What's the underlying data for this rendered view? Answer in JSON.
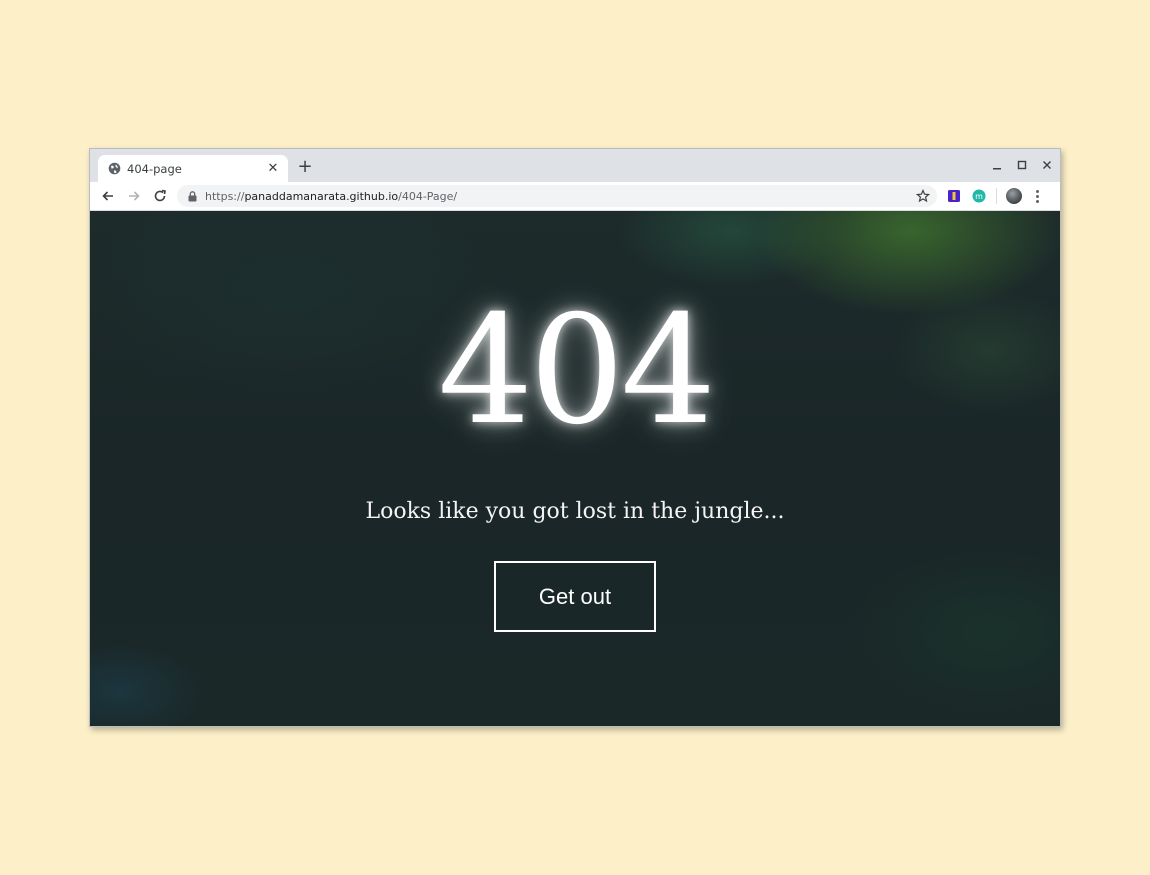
{
  "browser": {
    "tab": {
      "title": "404-page",
      "favicon": "globe-icon"
    },
    "new_tab_label": "+",
    "url": {
      "scheme": "https://",
      "host": "panaddamanarata.github.io",
      "path": "/404-Page/"
    },
    "extensions": [
      "extension-purple-icon",
      "extension-m-icon"
    ],
    "window_controls": [
      "minimize",
      "maximize",
      "close"
    ]
  },
  "page": {
    "headline": "404",
    "subtitle": "Looks like you got lost in the jungle...",
    "button_label": "Get out"
  },
  "colors": {
    "background": "#fdf0c9",
    "page_bg": "#1b2828",
    "text": "#ffffff"
  }
}
